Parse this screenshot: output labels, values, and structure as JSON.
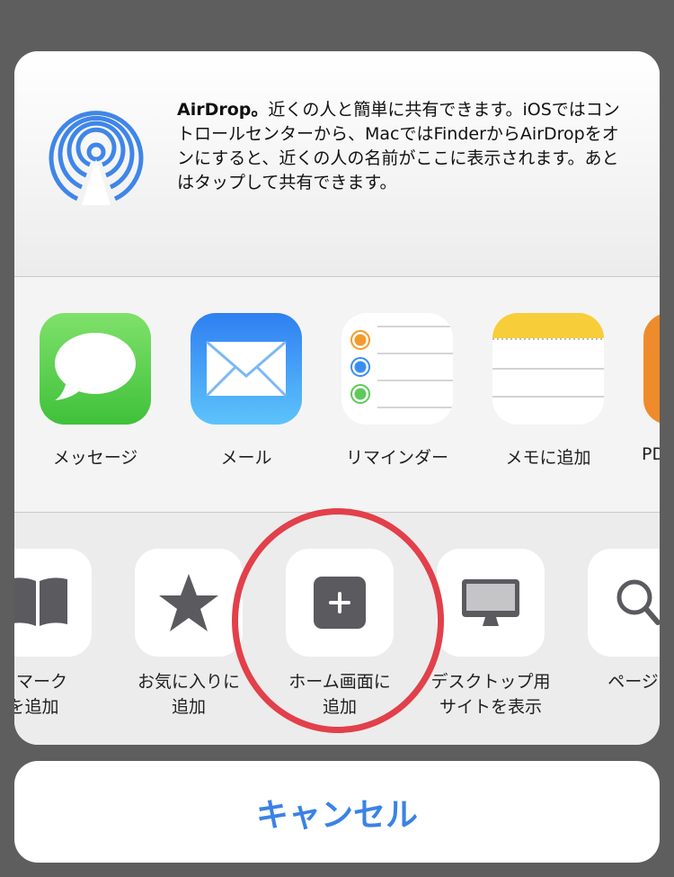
{
  "airdrop": {
    "title": "AirDrop。",
    "description": "近くの人と簡単に共有できます。iOSではコントロールセンターから、MacではFinderからAirDropをオンにすると、近くの人の名前がここに表示されます。あとはタップして共有できます。"
  },
  "apps": [
    {
      "label": "メッセージ",
      "icon": "messages-icon"
    },
    {
      "label": "メール",
      "icon": "mail-icon"
    },
    {
      "label": "リマインダー",
      "icon": "reminders-icon"
    },
    {
      "label": "メモに追加",
      "icon": "notes-icon"
    },
    {
      "label": "PD",
      "icon": "pdf-app-icon"
    }
  ],
  "actions": [
    {
      "label_line1": "クマーク",
      "label_line2": "を追加",
      "icon": "book-icon"
    },
    {
      "label_line1": "お気に入りに",
      "label_line2": "追加",
      "icon": "star-icon"
    },
    {
      "label_line1": "ホーム画面に",
      "label_line2": "追加",
      "icon": "plus-square-icon"
    },
    {
      "label_line1": "デスクトップ用",
      "label_line2": "サイトを表示",
      "icon": "desktop-icon"
    },
    {
      "label_line1": "ページを",
      "label_line2": "",
      "icon": "search-icon"
    }
  ],
  "cancel_label": "キャンセル",
  "colors": {
    "accent": "#3a82e6",
    "highlight_circle": "#e2404a",
    "icon_gray": "#5a5a5f"
  }
}
